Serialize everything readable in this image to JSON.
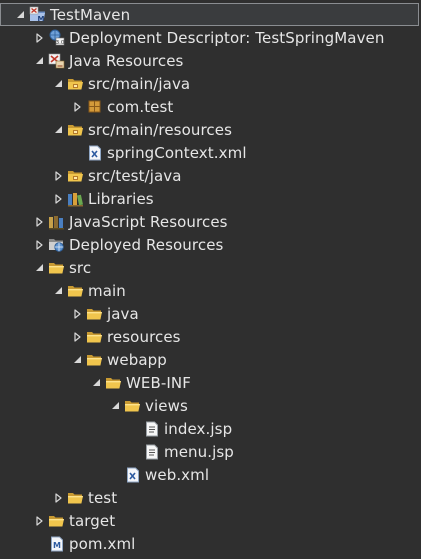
{
  "tree": {
    "items": [
      {
        "label": "TestMaven",
        "icon": "maven-project-icon",
        "twisty": "expanded",
        "depth": 0,
        "selected": true
      },
      {
        "label": "Deployment Descriptor: TestSpringMaven",
        "icon": "deployment-descriptor-icon",
        "twisty": "collapsed",
        "depth": 1
      },
      {
        "label": "Java Resources",
        "icon": "java-resources-icon",
        "twisty": "expanded",
        "depth": 1
      },
      {
        "label": "src/main/java",
        "icon": "source-folder-icon",
        "twisty": "expanded",
        "depth": 2
      },
      {
        "label": "com.test",
        "icon": "package-icon",
        "twisty": "collapsed",
        "depth": 3
      },
      {
        "label": "src/main/resources",
        "icon": "source-folder-icon",
        "twisty": "expanded",
        "depth": 2
      },
      {
        "label": "springContext.xml",
        "icon": "xml-file-icon",
        "twisty": "none",
        "depth": 3
      },
      {
        "label": "src/test/java",
        "icon": "source-folder-icon",
        "twisty": "collapsed",
        "depth": 2
      },
      {
        "label": "Libraries",
        "icon": "libraries-icon",
        "twisty": "collapsed",
        "depth": 2
      },
      {
        "label": "JavaScript Resources",
        "icon": "javascript-resources-icon",
        "twisty": "collapsed",
        "depth": 1
      },
      {
        "label": "Deployed Resources",
        "icon": "deployed-resources-icon",
        "twisty": "collapsed",
        "depth": 1
      },
      {
        "label": "src",
        "icon": "folder-icon",
        "twisty": "expanded",
        "depth": 1
      },
      {
        "label": "main",
        "icon": "folder-icon",
        "twisty": "expanded",
        "depth": 2
      },
      {
        "label": "java",
        "icon": "folder-icon",
        "twisty": "collapsed",
        "depth": 3
      },
      {
        "label": "resources",
        "icon": "folder-icon",
        "twisty": "collapsed",
        "depth": 3
      },
      {
        "label": "webapp",
        "icon": "folder-icon",
        "twisty": "expanded",
        "depth": 3
      },
      {
        "label": "WEB-INF",
        "icon": "folder-icon",
        "twisty": "expanded",
        "depth": 4
      },
      {
        "label": "views",
        "icon": "folder-icon",
        "twisty": "expanded",
        "depth": 5
      },
      {
        "label": "index.jsp",
        "icon": "jsp-file-icon",
        "twisty": "none",
        "depth": 6
      },
      {
        "label": "menu.jsp",
        "icon": "jsp-file-icon",
        "twisty": "none",
        "depth": 6
      },
      {
        "label": "web.xml",
        "icon": "xml-file-icon",
        "twisty": "none",
        "depth": 5
      },
      {
        "label": "test",
        "icon": "folder-icon",
        "twisty": "collapsed",
        "depth": 2
      },
      {
        "label": "target",
        "icon": "folder-icon",
        "twisty": "collapsed",
        "depth": 1
      },
      {
        "label": "pom.xml",
        "icon": "maven-pom-icon",
        "twisty": "none",
        "depth": 1
      }
    ]
  }
}
